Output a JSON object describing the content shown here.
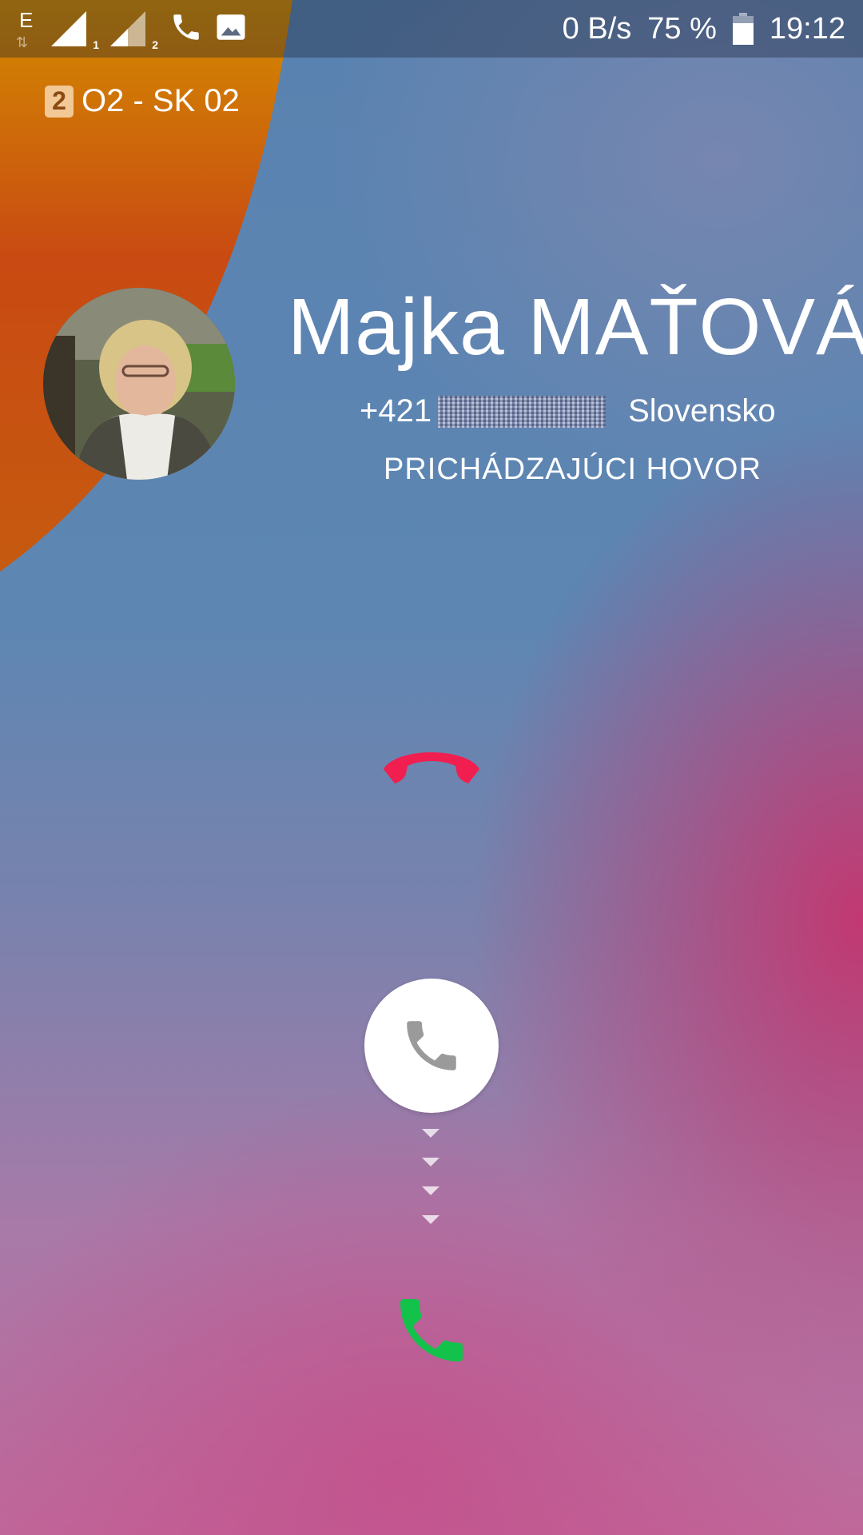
{
  "status_bar": {
    "network_type": "E",
    "sim1_label": "1",
    "sim2_label": "2",
    "icons": [
      "signal-sim1-icon",
      "signal-sim2-icon",
      "phone-call-icon",
      "image-icon",
      "battery-icon"
    ],
    "net_speed": "0 B/s",
    "battery_percent": "75 %",
    "battery_level": 0.75,
    "time": "19:12"
  },
  "carrier": {
    "sim_badge": "2",
    "name": "O2 - SK 02"
  },
  "caller": {
    "name": "Majka MAŤOVÁ",
    "number_prefix": "+421",
    "country": "Slovensko",
    "call_status": "PRICHÁDZAJÚCI HOVOR"
  },
  "actions": {
    "decline_icon": "hang-up-icon",
    "answer_knob_icon": "phone-icon",
    "accept_icon": "phone-answer-icon"
  },
  "colors": {
    "decline": "#f01f4f",
    "accept": "#12c24a",
    "knob_icon": "#9a9a9a",
    "carrier_blob": "#d8601a"
  }
}
